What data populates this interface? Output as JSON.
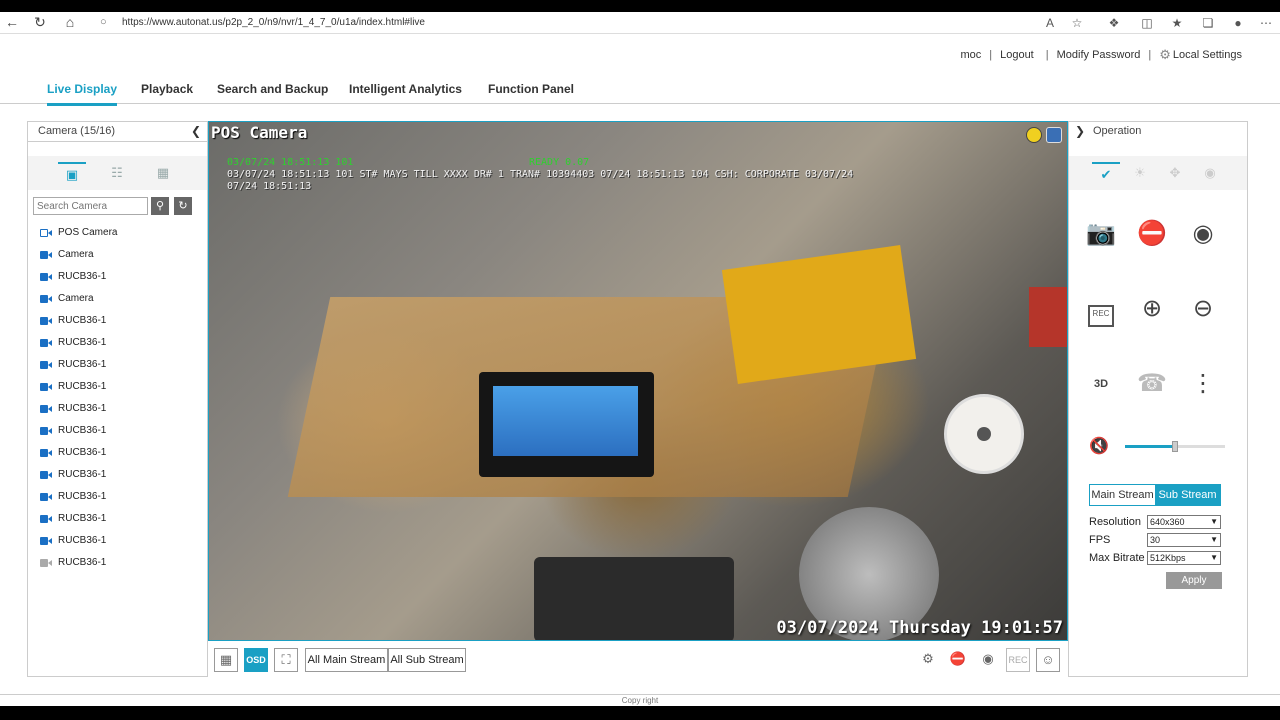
{
  "browser": {
    "url": "https://www.autonat.us/p2p_2_0/n9/nvr/1_4_7_0/u1a/index.html#live"
  },
  "user": {
    "username": "moc",
    "logout": "Logout",
    "modify_password": "Modify Password",
    "local_settings": "Local Settings"
  },
  "menu": [
    {
      "label": "Live Display",
      "active": true
    },
    {
      "label": "Playback"
    },
    {
      "label": "Search and Backup"
    },
    {
      "label": "Intelligent Analytics"
    },
    {
      "label": "Function Panel"
    }
  ],
  "left_panel": {
    "title": "Camera (15/16)",
    "search_placeholder": "Search Camera",
    "cameras": [
      {
        "name": "POS Camera",
        "status": "pos"
      },
      {
        "name": "Camera",
        "status": "online"
      },
      {
        "name": "RUCB36-1",
        "status": "online"
      },
      {
        "name": "Camera",
        "status": "online"
      },
      {
        "name": "RUCB36-1",
        "status": "online"
      },
      {
        "name": "RUCB36-1",
        "status": "online"
      },
      {
        "name": "RUCB36-1",
        "status": "online"
      },
      {
        "name": "RUCB36-1",
        "status": "online"
      },
      {
        "name": "RUCB36-1",
        "status": "online"
      },
      {
        "name": "RUCB36-1",
        "status": "online"
      },
      {
        "name": "RUCB36-1",
        "status": "online"
      },
      {
        "name": "RUCB36-1",
        "status": "online"
      },
      {
        "name": "RUCB36-1",
        "status": "online"
      },
      {
        "name": "RUCB36-1",
        "status": "online"
      },
      {
        "name": "RUCB36-1",
        "status": "online"
      },
      {
        "name": "RUCB36-1",
        "status": "offline"
      }
    ]
  },
  "video": {
    "title": "POS Camera",
    "osd_line1": "03/07/24 18:51:13 101",
    "osd_line1b": "READY        0.07",
    "osd_line2": "03/07/24 18:51:13 101 ST# MAYS   TILL XXXX DR# 1 TRAN# 10394403 07/24 18:51:13 104 CSH: CORPORATE        03/07/24",
    "osd_line3": "07/24 18:51:13",
    "timestamp": "03/07/2024 Thursday 19:01:57"
  },
  "video_toolbar": {
    "osd": "OSD",
    "all_main": "All Main Stream",
    "all_sub": "All Sub Stream",
    "rec": "REC"
  },
  "right_panel": {
    "title": "Operation",
    "rec_label": "REC",
    "zoom_3d": "3D",
    "volume": 0.5,
    "stream_tabs": [
      "Main Stream",
      "Sub Stream"
    ],
    "resolution_label": "Resolution",
    "resolution_value": "640x360",
    "fps_label": "FPS",
    "fps_value": "30",
    "bitrate_label": "Max Bitrate",
    "bitrate_value": "512Kbps",
    "apply": "Apply"
  },
  "footer": {
    "text": "Copy right"
  },
  "colors": {
    "accent": "#1aa0c4",
    "camera_icon": "#1a6fc4"
  }
}
